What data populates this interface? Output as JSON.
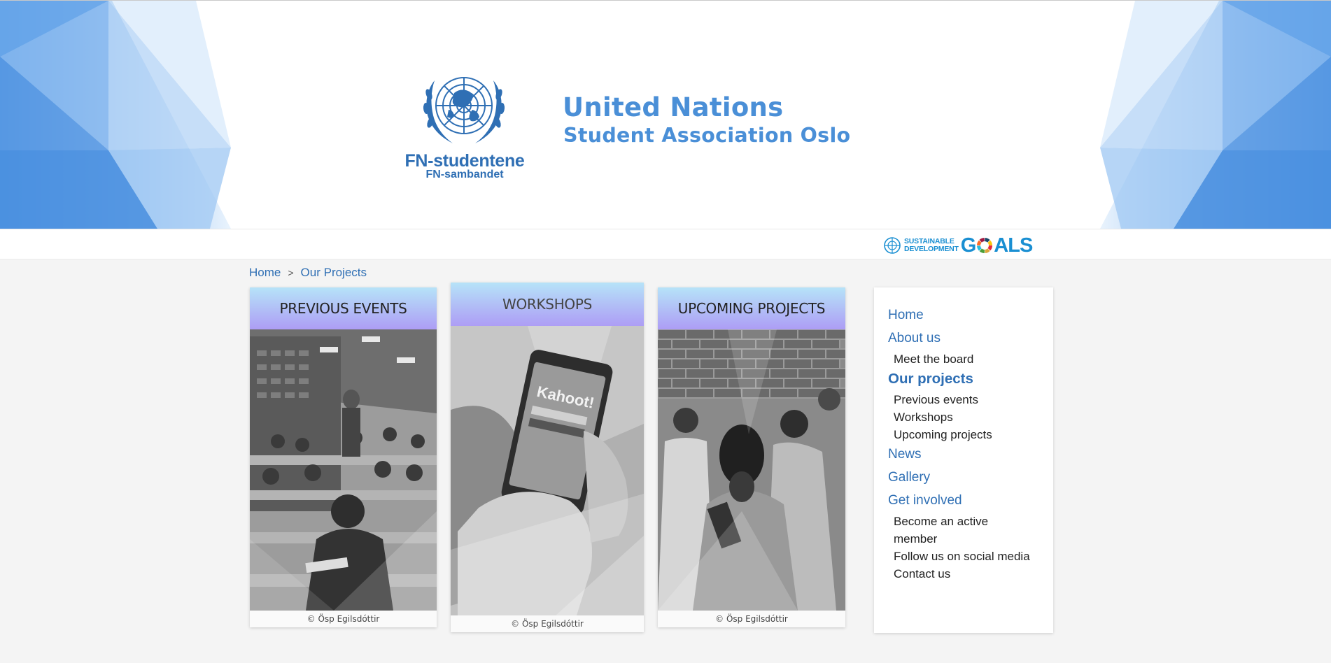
{
  "header": {
    "logo_name": "FN-studentene",
    "logo_sub": "FN-sambandet",
    "title": "United Nations",
    "subtitle": "Student Association Oslo"
  },
  "sdg": {
    "line1": "SUSTAINABLE",
    "line2": "DEVELOPMENT",
    "goals_prefix": "G",
    "goals_suffix": "ALS"
  },
  "breadcrumb": {
    "home": "Home",
    "separator": ">",
    "current": "Our Projects"
  },
  "cards": [
    {
      "title": "PREVIOUS EVENTS",
      "credit": "© Ösp Egilsdóttir"
    },
    {
      "title": "WORKSHOPS",
      "credit": "© Ösp Egilsdóttir"
    },
    {
      "title": "UPCOMING PROJECTS",
      "credit": "© Ösp Egilsdóttir"
    }
  ],
  "sidebar": {
    "home": "Home",
    "about": "About us",
    "about_sub": [
      "Meet the board"
    ],
    "projects": "Our projects",
    "projects_sub": [
      "Previous events",
      "Workshops",
      "Upcoming projects"
    ],
    "news": "News",
    "gallery": "Gallery",
    "involved": "Get involved",
    "involved_sub": [
      "Become an active member",
      "Follow us on social media",
      "Contact us"
    ]
  },
  "colors": {
    "accent_blue": "#2f6fb4",
    "title_blue": "#4a8fd7",
    "card_gradient_top": "#b6e3f8",
    "card_gradient_bottom": "#ad9df5"
  }
}
